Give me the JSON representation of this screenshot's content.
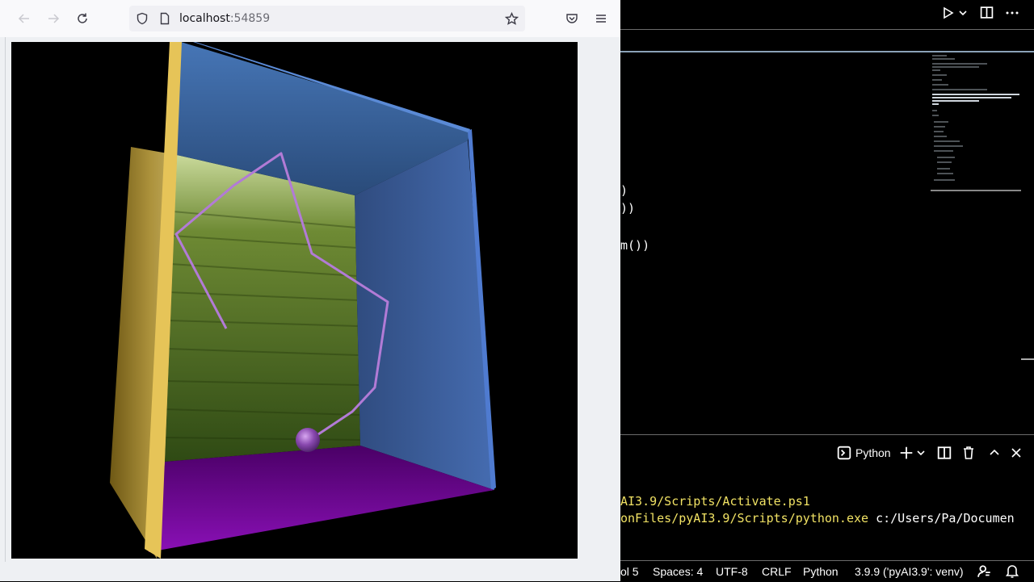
{
  "browser": {
    "url_host": "localhost",
    "url_port": ":54859"
  },
  "scene_colors": {
    "left_wall": "#d8b640",
    "right_wall": "#4a6fb4",
    "ceiling": "#3f73b4",
    "back_wall": "#3d5a1e",
    "floor": "#7a00a0",
    "string": "#b27bd6",
    "ball": "#8a4ab0"
  },
  "editor": {
    "code_lines": [
      ")",
      "))",
      "m())"
    ],
    "terminal": {
      "profile_label": "Python",
      "line1": "AI3.9/Scripts/Activate.ps1",
      "line2_prefix": "onFiles/pyAI3.9/Scripts/python.exe",
      "line2_suffix": " c:/Users/Pa/Documen"
    },
    "status": {
      "col": "ol 5",
      "spaces": "Spaces: 4",
      "encoding": "UTF-8",
      "eol": "CRLF",
      "language": "Python",
      "interpreter": "3.9.9 ('pyAI3.9': venv)"
    }
  }
}
